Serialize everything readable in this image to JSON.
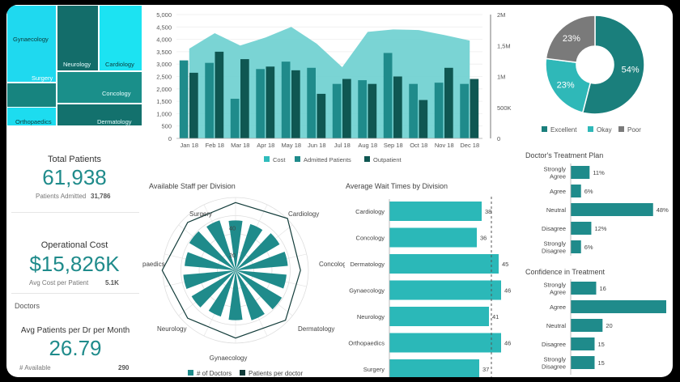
{
  "treemap": {
    "tiles": [
      {
        "label": "Gynaecology",
        "color": "#1fd9ef"
      },
      {
        "label": "Neurology",
        "color": "#136d6a"
      },
      {
        "label": "Cardiology",
        "color": "#1ce3f2"
      },
      {
        "label": "Surgery",
        "color": "#17847f"
      },
      {
        "label": "Concology",
        "color": "#1a8f8a"
      },
      {
        "label": "Orthopaedics",
        "color": "#1ddcef"
      },
      {
        "label": "Dermatology",
        "color": "#13716d"
      }
    ]
  },
  "kpis": {
    "total_patients": {
      "title": "Total Patients",
      "value": "61,938",
      "sub_label": "Patients Admitted",
      "sub_value": "31,786"
    },
    "operational_cost": {
      "title": "Operational Cost",
      "value": "$15,826K",
      "sub_label": "Avg Cost per Patient",
      "sub_value": "5.1K"
    },
    "doctors": {
      "section": "Doctors",
      "title": "Avg Patients per Dr per Month",
      "value": "26.79",
      "sub_label": "# Available",
      "sub_value": "290"
    }
  },
  "colors": {
    "teal_light": "#2bb8b8",
    "teal": "#1f8b8b",
    "teal_dark": "#0f5752",
    "area": "#7fd3d3",
    "grey": "#6d6d6d"
  },
  "chart_data": [
    {
      "type": "bar",
      "id": "monthly",
      "categories": [
        "Jan 18",
        "Feb 18",
        "Mar 18",
        "Apr 18",
        "May 18",
        "Jun 18",
        "Jul 18",
        "Aug 18",
        "Sep 18",
        "Oct 18",
        "Nov 18",
        "Dec 18"
      ],
      "series": [
        {
          "name": "Cost",
          "kind": "area",
          "axis": "right",
          "values": [
            1450000,
            1700000,
            1500000,
            1630000,
            1800000,
            1530000,
            1150000,
            1720000,
            1760000,
            1750000,
            1670000,
            1580000
          ]
        },
        {
          "name": "Admitted Patients",
          "kind": "bar",
          "axis": "left",
          "values": [
            3150,
            3050,
            1600,
            2800,
            3100,
            2850,
            2200,
            2350,
            3450,
            2200,
            2250,
            2200
          ]
        },
        {
          "name": "Outpatient",
          "kind": "bar",
          "axis": "left",
          "values": [
            2650,
            3500,
            3200,
            2900,
            2750,
            1800,
            2400,
            2200,
            2500,
            1550,
            2850,
            2400
          ]
        }
      ],
      "y_left_ticks": [
        "0",
        "500",
        "1,000",
        "1,500",
        "2,000",
        "2,500",
        "3,000",
        "3,500",
        "4,000",
        "4,500",
        "5,000"
      ],
      "y_right_ticks": [
        "0",
        "500K",
        "1M",
        "1,5M",
        "2M"
      ],
      "ylim": [
        0,
        5000
      ],
      "ylim_right": [
        0,
        2000000
      ],
      "legend_position": "bottom"
    },
    {
      "type": "pie",
      "id": "satisfaction",
      "labels": [
        "Excellent",
        "Okay",
        "Poor"
      ],
      "values": [
        54,
        23,
        23
      ],
      "value_labels": [
        "54%",
        "23%",
        "23%"
      ],
      "colors": [
        "#1a7f7c",
        "#2fb8b8",
        "#7a7a7a"
      ],
      "legend_position": "bottom"
    },
    {
      "type": "radar",
      "id": "staff",
      "title": "Available Staff per Division",
      "categories": [
        "Cardiology",
        "Concology",
        "Dermatology",
        "Gynaecology",
        "Neurology",
        "paedics",
        "Surgery"
      ],
      "series": [
        {
          "name": "# of Doctors",
          "values": [
            38,
            37,
            39,
            40,
            39,
            41,
            40
          ]
        },
        {
          "name": "Patients per doctor",
          "values": [
            24,
            26,
            23,
            25,
            24,
            24,
            26
          ]
        }
      ],
      "scale_ticks": [
        "40",
        "20"
      ],
      "rmax": 40,
      "legend_position": "bottom"
    },
    {
      "type": "bar",
      "id": "wait",
      "orientation": "horizontal",
      "title": "Average Wait Times by Division",
      "categories": [
        "Cardiology",
        "Concology",
        "Dermatology",
        "Gynaecology",
        "Neurology",
        "Orthopaedics",
        "Surgery"
      ],
      "values": [
        38,
        36,
        45,
        46,
        41,
        46,
        37
      ],
      "value_labels": [
        "38",
        "36",
        "45",
        "46",
        "41",
        "46",
        "37"
      ],
      "target": 42,
      "xlim": [
        0,
        50
      ]
    },
    {
      "type": "bar",
      "id": "plan",
      "orientation": "horizontal",
      "title": "Doctor's Treatment Plan",
      "categories": [
        "Strongly Agree",
        "Agree",
        "Neutral",
        "Disagree",
        "Strongly Disagree"
      ],
      "values": [
        11,
        6,
        48,
        12,
        6
      ],
      "value_labels": [
        "11%",
        "6%",
        "48%",
        "12%",
        "6%"
      ],
      "xlim": [
        0,
        50
      ]
    },
    {
      "type": "bar",
      "id": "confidence",
      "orientation": "horizontal",
      "title": "Confidence in Treatment",
      "categories": [
        "Strongly Agree",
        "Agree",
        "Neutral",
        "Disagree",
        "Strongly Disagree"
      ],
      "values": [
        16,
        60,
        20,
        15,
        15
      ],
      "value_labels": [
        "16",
        "",
        "20",
        "15",
        "15"
      ],
      "xlim": [
        0,
        60
      ]
    }
  ]
}
